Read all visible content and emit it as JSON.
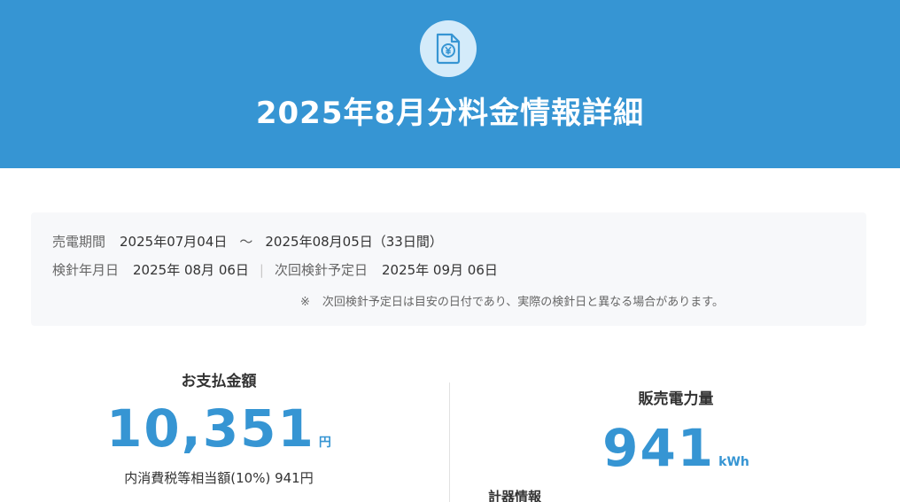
{
  "header": {
    "title": "2025年8月分料金情報詳細",
    "icon": "yen-document-icon",
    "bg_color": "#3695d3"
  },
  "info": {
    "period_label": "売電期間",
    "period_start": "2025年07月04日",
    "period_tilde": "〜",
    "period_end": "2025年08月05日（33日間）",
    "meter_date_label": "検針年月日",
    "meter_date": "2025年 08月 06日",
    "separator": "|",
    "next_meter_label": "次回検針予定日",
    "next_meter_date": "2025年 09月 06日",
    "note_mark": "※",
    "note_text": "次回検針予定日は目安の日付であり、実際の検針日と異なる場合があります。"
  },
  "payment": {
    "label": "お支払金額",
    "amount": "10,351",
    "unit": "円",
    "tax": "内消費税等相当額(10%) 941円"
  },
  "power": {
    "label": "販売電力量",
    "amount": "941",
    "unit": "kWh"
  },
  "meter_info": {
    "title": "計器情報"
  },
  "colors": {
    "accent": "#3695d3",
    "icon_bg": "#d4ebfa",
    "info_bg": "#f7f8fa"
  }
}
